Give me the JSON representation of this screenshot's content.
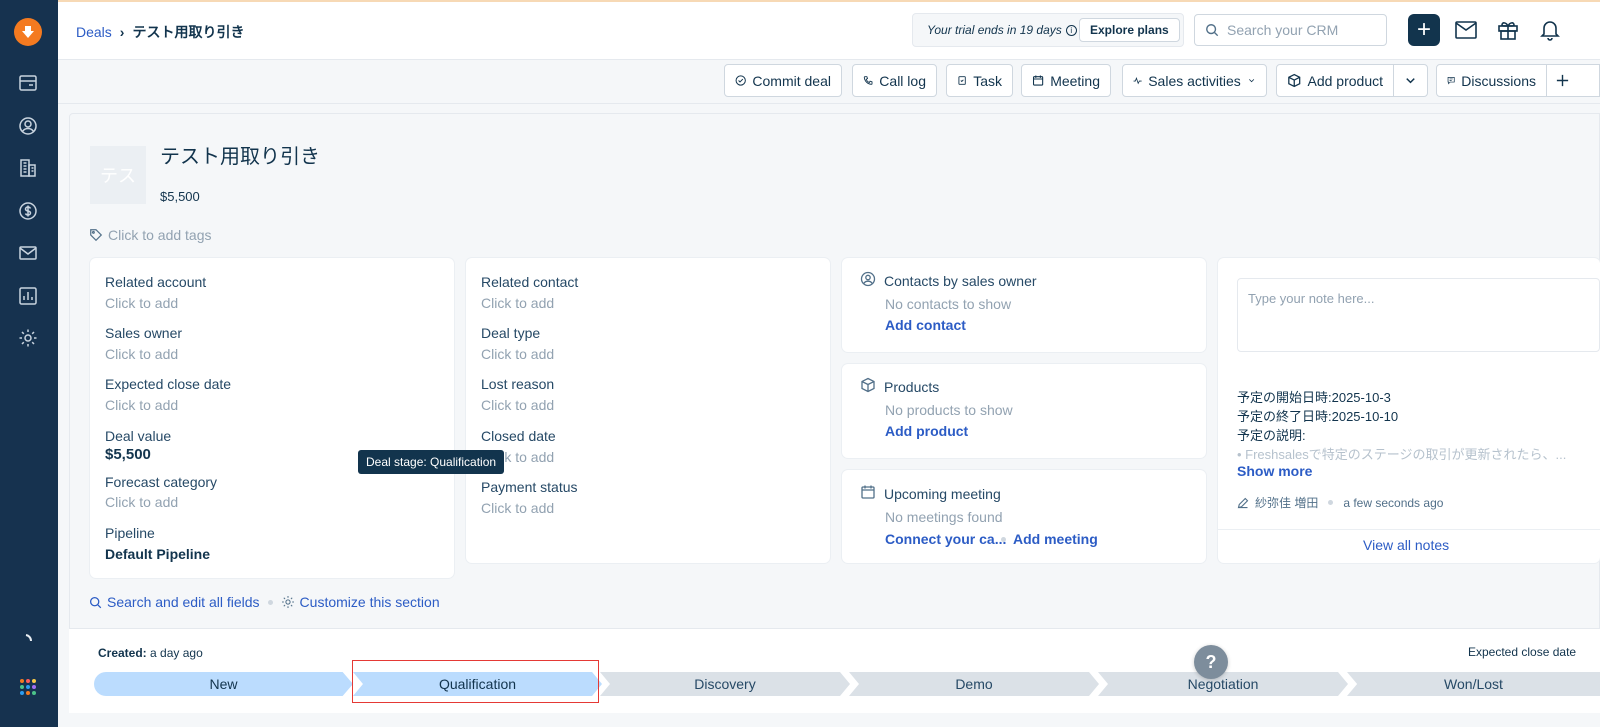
{
  "breadcrumb": {
    "root": "Deals",
    "current": "テスト用取り引き"
  },
  "trial": {
    "text": "Your trial ends in 19 days",
    "cta": "Explore plans"
  },
  "search": {
    "placeholder": "Search your CRM"
  },
  "toolbar": {
    "commit_deal": "Commit deal",
    "call_log": "Call log",
    "task": "Task",
    "meeting": "Meeting",
    "sales_activities": "Sales activities",
    "add_product": "Add product",
    "discussions": "Discussions"
  },
  "deal": {
    "avatar_text": "テス",
    "title": "テスト用取り引き",
    "amount": "$5,500",
    "tags_placeholder": "Click to add tags"
  },
  "fields_left": [
    {
      "label": "Related account",
      "value": "Click to add"
    },
    {
      "label": "Sales owner",
      "value": "Click to add"
    },
    {
      "label": "Expected close date",
      "value": "Click to add"
    },
    {
      "label": "Deal value",
      "value": "$5,500"
    },
    {
      "label": "Forecast category",
      "value": "Click to add"
    },
    {
      "label": "Pipeline",
      "value": "Default Pipeline"
    }
  ],
  "fields_mid": [
    {
      "label": "Related contact",
      "value": "Click to add"
    },
    {
      "label": "Deal type",
      "value": "Click to add"
    },
    {
      "label": "Lost reason",
      "value": "Click to add"
    },
    {
      "label": "Closed date",
      "value": "Click to add"
    },
    {
      "label": "Payment status",
      "value": "Click to add"
    }
  ],
  "tooltip": "Deal stage: Qualification",
  "widgets": {
    "contacts": {
      "title": "Contacts by sales owner",
      "empty": "No contacts to show",
      "action": "Add contact"
    },
    "products": {
      "title": "Products",
      "empty": "No products to show",
      "action": "Add product"
    },
    "meeting": {
      "title": "Upcoming meeting",
      "empty": "No meetings found",
      "action1": "Connect your ca...",
      "action2": "Add meeting"
    }
  },
  "notes": {
    "placeholder": "Type your note here...",
    "lines": [
      "予定の開始日時:2025-10-3",
      "予定の終了日時:2025-10-10",
      "予定の説明:",
      "• Freshsalesで特定のステージの取引が更新されたら、..."
    ],
    "show_more": "Show more",
    "author": "紗弥佳 増田",
    "time": "a few seconds ago",
    "view_all": "View all notes"
  },
  "bottom": {
    "search_fields": "Search and edit all fields",
    "customize": "Customize this section"
  },
  "stages_bar": {
    "created_label": "Created:",
    "created_value": "a day ago",
    "expected_close": "Expected close date",
    "stages": [
      "New",
      "Qualification",
      "Discovery",
      "Demo",
      "Negotiation",
      "Won/Lost"
    ]
  },
  "help": "?",
  "colors": {
    "sidebar": "#16324f",
    "accent": "#2c5cc5",
    "brand": "#f47a20",
    "stage_done": "#bbdcfe",
    "stage_todo": "#dbe1e7"
  }
}
